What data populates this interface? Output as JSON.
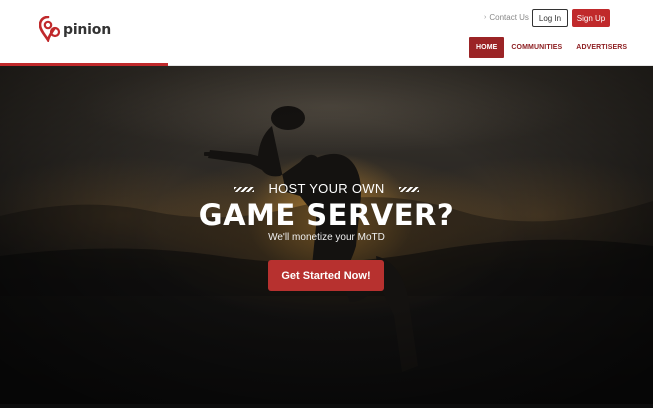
{
  "brand": {
    "name": "pinion",
    "accent_color": "#c0292b"
  },
  "header": {
    "contact_label": "Contact Us",
    "login_label": "Log In",
    "signup_label": "Sign Up"
  },
  "nav": {
    "items": [
      {
        "label": "HOME",
        "active": true
      },
      {
        "label": "COMMUNITIES",
        "active": false
      },
      {
        "label": "ADVERTISERS",
        "active": false
      }
    ]
  },
  "hero": {
    "subtitle": "HOST YOUR OWN",
    "title": "GAME SERVER?",
    "tagline": "We'll monetize your MoTD",
    "cta_label": "Get Started Now!"
  },
  "icons": {
    "logo": "pinion-logo-icon",
    "contact": "chevron-right-icon"
  }
}
